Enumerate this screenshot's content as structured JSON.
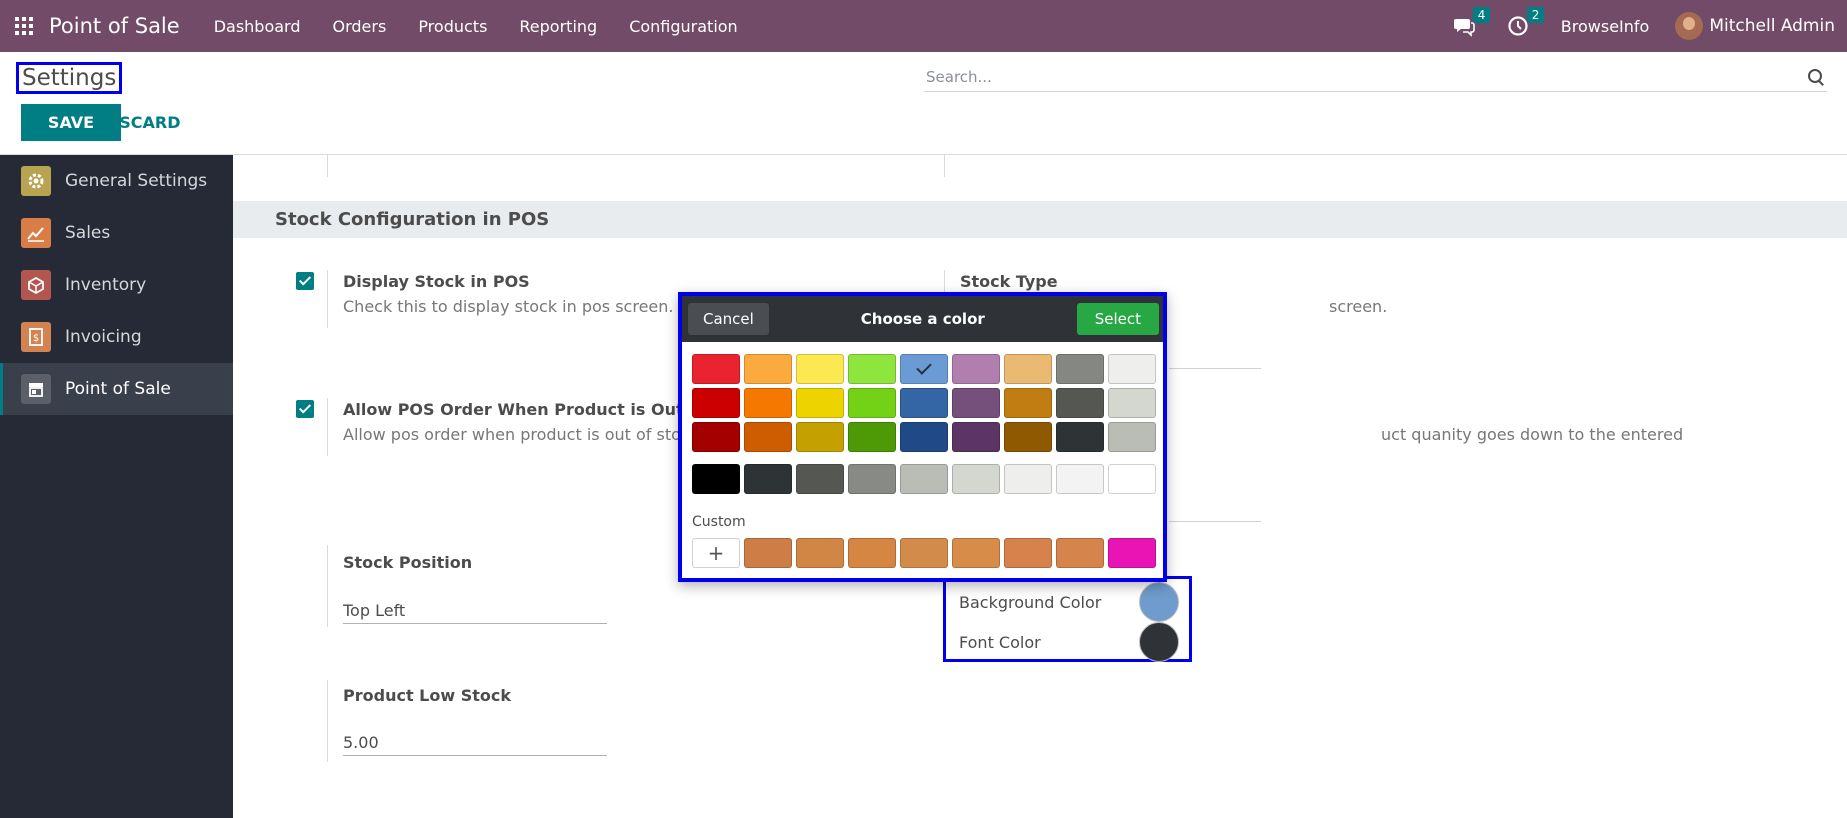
{
  "navbar": {
    "app_name": "Point of Sale",
    "menu": [
      "Dashboard",
      "Orders",
      "Products",
      "Reporting",
      "Configuration"
    ],
    "messages_count": "4",
    "activities_count": "2",
    "company": "BrowseInfo",
    "user": "Mitchell Admin"
  },
  "control": {
    "title": "Settings",
    "save_label": "SAVE",
    "discard_label": "DISCARD",
    "search_placeholder": "Search..."
  },
  "sidebar": {
    "items": [
      {
        "label": "General Settings",
        "icon": "gear-icon",
        "color": "#b8a350"
      },
      {
        "label": "Sales",
        "icon": "chart-up-icon",
        "color": "#d77d45"
      },
      {
        "label": "Inventory",
        "icon": "box-icon",
        "color": "#b2574f"
      },
      {
        "label": "Invoicing",
        "icon": "invoice-icon",
        "color": "#d3834f"
      },
      {
        "label": "Point of Sale",
        "icon": "shop-icon",
        "color": "#5a5f6a"
      }
    ]
  },
  "section": {
    "title": "Stock Configuration in POS",
    "display_stock_title": "Display Stock in POS",
    "display_stock_desc": "Check this to display stock in pos screen.",
    "stock_type_title": "Stock Type",
    "stock_type_desc_visible": "screen.",
    "allow_order_title": "Allow POS Order When Product is Out of St",
    "allow_order_desc": "Allow pos order when product is out of stoc",
    "deny_desc_visible": "uct quanity goes down to the entered",
    "stock_position_title": "Stock Position",
    "stock_position_value": "Top Left",
    "low_stock_title": "Product Low Stock",
    "low_stock_value": "5.00",
    "background_color_label": "Background Color",
    "font_color_label": "Font Color",
    "background_color": "#6f9ccc",
    "font_color": "#2f3337"
  },
  "picker": {
    "title": "Choose a color",
    "cancel_label": "Cancel",
    "select_label": "Select",
    "custom_label": "Custom",
    "selected_index": 4,
    "palette": [
      "#e9232f",
      "#fbab3e",
      "#fce850",
      "#8ee53d",
      "#6b9bd4",
      "#b07fad",
      "#eab972",
      "#848782",
      "#eeeeec",
      "#cc0000",
      "#f57900",
      "#edd400",
      "#73d216",
      "#3465a4",
      "#75507b",
      "#c17d11",
      "#555753",
      "#d3d7cf",
      "#a40000",
      "#ce5c00",
      "#c4a000",
      "#4e9a06",
      "#204a87",
      "#5c3566",
      "#8f5902",
      "#2e3436",
      "#babdb6"
    ],
    "grays": [
      "#000000",
      "#2e3436",
      "#555753",
      "#888a85",
      "#babdb6",
      "#d3d7cf",
      "#eeeeec",
      "#f3f3f3",
      "#ffffff"
    ],
    "custom": [
      "#ce7d47",
      "#d28645",
      "#d58643",
      "#d38b4b",
      "#d78c4a",
      "#d7814d",
      "#d5844c",
      "#ea14b5"
    ]
  }
}
